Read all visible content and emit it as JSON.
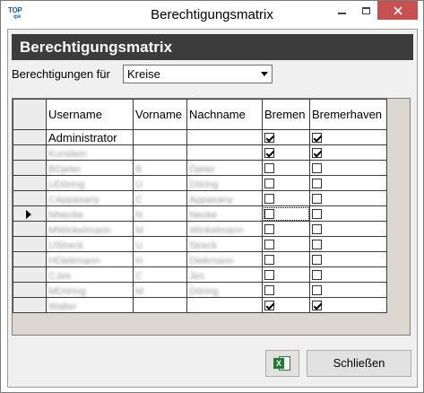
{
  "window": {
    "title": "Berechtigungsmatrix",
    "logo_text": "TOP",
    "logo_sub": "qw"
  },
  "header": {
    "title": "Berechtigungsmatrix"
  },
  "filter": {
    "label": "Berechtigungen für",
    "selected": "Kreise"
  },
  "grid": {
    "columns": [
      "Username",
      "Vorname",
      "Nachname",
      "Bremen",
      "Bremerhaven"
    ],
    "rows": [
      {
        "username": "Administrator",
        "vorname": "",
        "nachname": "",
        "bremen": true,
        "bremerhaven": true,
        "blurred": false
      },
      {
        "username": "Kunstein",
        "vorname": "",
        "nachname": "",
        "bremen": true,
        "bremerhaven": true,
        "blurred": true
      },
      {
        "username": "BDjeter",
        "vorname": "B",
        "nachname": "Djeter",
        "bremen": false,
        "bremerhaven": false,
        "blurred": true
      },
      {
        "username": "UDöring",
        "vorname": "U",
        "nachname": "Döring",
        "bremen": false,
        "bremerhaven": false,
        "blurred": true
      },
      {
        "username": "CAppasany",
        "vorname": "C",
        "nachname": "Appasany",
        "bremen": false,
        "bremerhaven": false,
        "blurred": true
      },
      {
        "username": "NNecke",
        "vorname": "N",
        "nachname": "Necke",
        "bremen": false,
        "bremerhaven": false,
        "blurred": true,
        "current": true
      },
      {
        "username": "MWinkelmann",
        "vorname": "M",
        "nachname": "Winkelmann",
        "bremen": false,
        "bremerhaven": false,
        "blurred": true
      },
      {
        "username": "UStreck",
        "vorname": "U",
        "nachname": "Streck",
        "bremen": false,
        "bremerhaven": false,
        "blurred": true
      },
      {
        "username": "HDiekmann",
        "vorname": "H",
        "nachname": "Diekmann",
        "bremen": false,
        "bremerhaven": false,
        "blurred": true
      },
      {
        "username": "CJes",
        "vorname": "C",
        "nachname": "Jes",
        "bremen": false,
        "bremerhaven": false,
        "blurred": true
      },
      {
        "username": "MDöring",
        "vorname": "M",
        "nachname": "Döring",
        "bremen": false,
        "bremerhaven": false,
        "blurred": true
      },
      {
        "username": "Walter",
        "vorname": "",
        "nachname": "",
        "bremen": true,
        "bremerhaven": true,
        "blurred": true
      }
    ]
  },
  "buttons": {
    "excel_icon": "excel-icon",
    "close_label": "Schließen"
  }
}
